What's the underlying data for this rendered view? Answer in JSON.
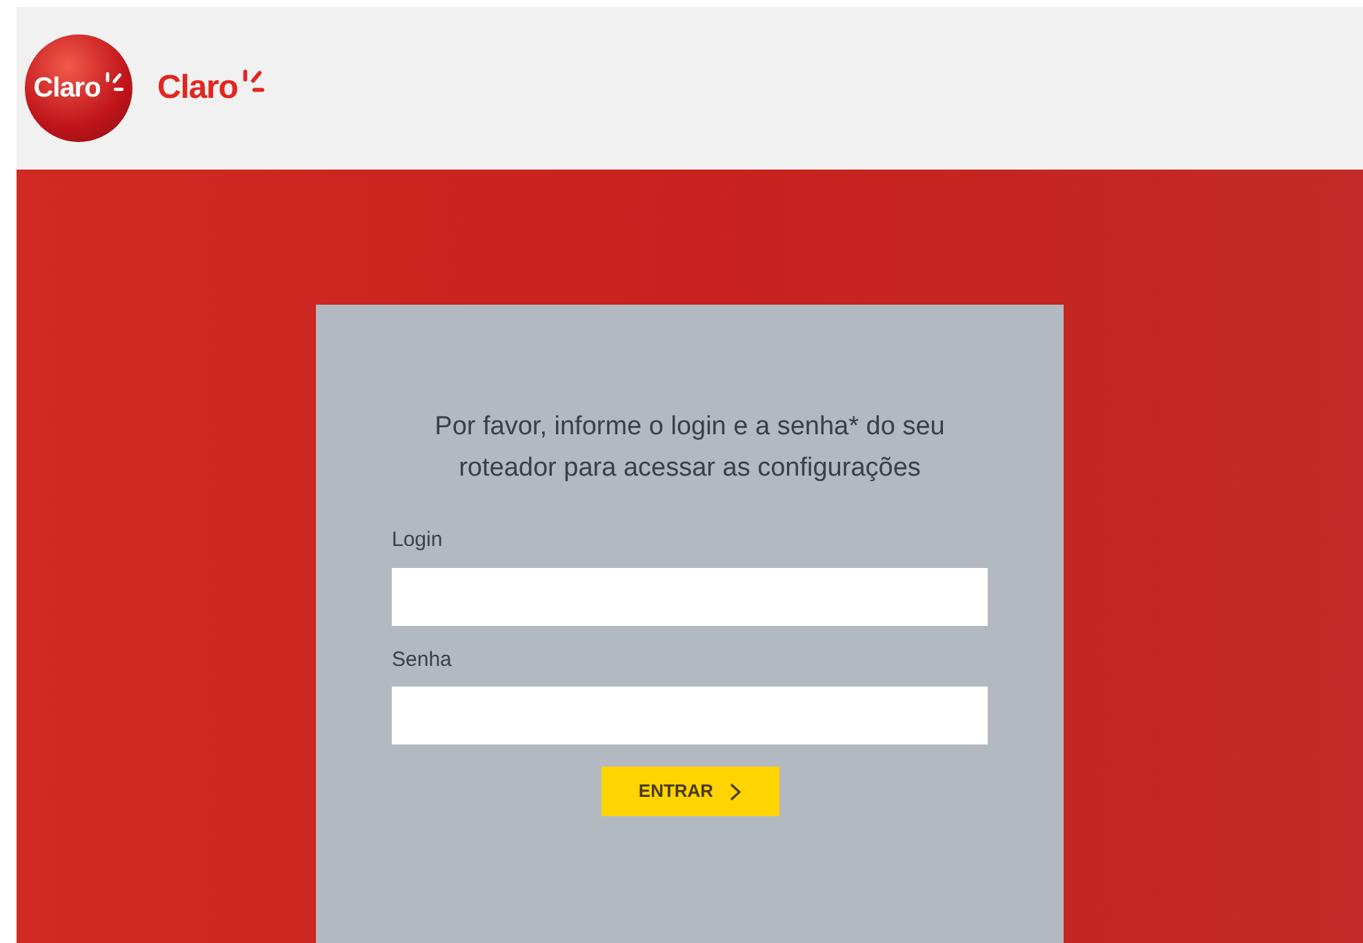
{
  "header": {
    "logos": [
      {
        "kind": "badge",
        "text": "Claro"
      },
      {
        "kind": "wordmark",
        "text": "Claro"
      }
    ]
  },
  "login_card": {
    "heading": "Por favor, informe o login e a senha* do seu roteador para acessar as configurações",
    "fields": [
      {
        "label": "Login"
      },
      {
        "label": "Senha"
      }
    ],
    "submit_button": "ENTRAR"
  }
}
